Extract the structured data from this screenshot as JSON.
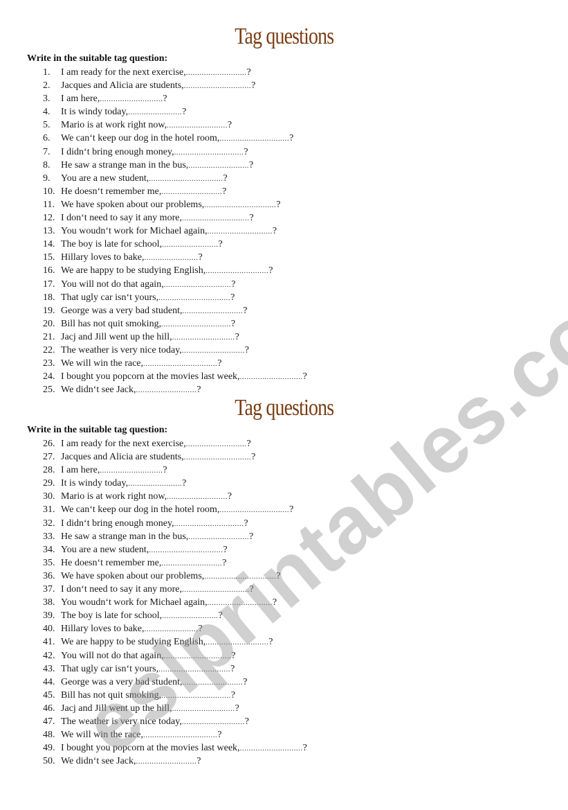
{
  "watermark": "eslprintables.com",
  "sections": [
    {
      "title": "Tag questions",
      "instruction": "Write in the suitable tag question:",
      "items": [
        {
          "num": "1.",
          "text": "I am ready for the next exercise,",
          "blank": "..........................."
        },
        {
          "num": "2.",
          "text": "Jacques and Alicia are students,",
          "blank": ".............................."
        },
        {
          "num": "3.",
          "text": "I am here,",
          "blank": "............................"
        },
        {
          "num": "4.",
          "text": "It is windy today,",
          "blank": "........................"
        },
        {
          "num": "5.",
          "text": "Mario is at work right now,",
          "blank": "..........................."
        },
        {
          "num": "6.",
          "text": "We can‘t keep our dog in the hotel room,",
          "blank": "..............................."
        },
        {
          "num": "7.",
          "text": "I didn‘t bring enough money,",
          "blank": "..............................."
        },
        {
          "num": "8.",
          "text": "He saw a strange man in the bus,",
          "blank": "..........................."
        },
        {
          "num": "9.",
          "text": "You are a new student,",
          "blank": "................................."
        },
        {
          "num": "10.",
          "text": "He doesn‘t remember me,",
          "blank": "..........................."
        },
        {
          "num": "11.",
          "text": "We have spoken about our problems,",
          "blank": "................................"
        },
        {
          "num": "12.",
          "text": "I don‘t need to say it any more,",
          "blank": ".............................."
        },
        {
          "num": "13.",
          "text": "You woudn‘t work for Michael again,",
          "blank": "............................."
        },
        {
          "num": "14.",
          "text": "The boy is late for school,",
          "blank": "........................."
        },
        {
          "num": "15.",
          "text": "Hillary loves to bake,",
          "blank": "........................"
        },
        {
          "num": "16.",
          "text": "We are happy to be studying English,",
          "blank": "............................"
        },
        {
          "num": "17.",
          "text": "You will not do that again,",
          "blank": ".............................."
        },
        {
          "num": "18.",
          "text": "That ugly car isn‘t yours,",
          "blank": "................................"
        },
        {
          "num": "19.",
          "text": "George was a very bad student,",
          "blank": "..........................."
        },
        {
          "num": "20.",
          "text": "Bill has not quit smoking,",
          "blank": "..............................."
        },
        {
          "num": "21.",
          "text": "Jacj and Jill went up the hill,",
          "blank": "............................"
        },
        {
          "num": "22.",
          "text": "The weather is very nice today,",
          "blank": "............................"
        },
        {
          "num": "23.",
          "text": "We will win the race,",
          "blank": "................................."
        },
        {
          "num": "24.",
          "text": "I bought you popcorn at the movies last week,",
          "blank": "............................"
        },
        {
          "num": "25.",
          "text": "We didn‘t see Jack,",
          "blank": "..........................."
        }
      ]
    },
    {
      "title": "Tag questions",
      "instruction": "Write in the suitable tag question:",
      "items": [
        {
          "num": "26.",
          "text": "I am ready for the next exercise,",
          "blank": "..........................."
        },
        {
          "num": "27.",
          "text": "Jacques and Alicia are students,",
          "blank": ".............................."
        },
        {
          "num": "28.",
          "text": "I am here,",
          "blank": "............................"
        },
        {
          "num": "29.",
          "text": "It is windy today,",
          "blank": "........................"
        },
        {
          "num": "30.",
          "text": "Mario is at work right now,",
          "blank": "..........................."
        },
        {
          "num": "31.",
          "text": "We can‘t keep our dog in the hotel room,",
          "blank": "..............................."
        },
        {
          "num": "32.",
          "text": "I didn‘t bring enough money,",
          "blank": "..............................."
        },
        {
          "num": "33.",
          "text": "He saw a strange man in the bus,",
          "blank": "..........................."
        },
        {
          "num": "34.",
          "text": "You are a new student,",
          "blank": "................................."
        },
        {
          "num": "35.",
          "text": "He doesn‘t remember me,",
          "blank": "..........................."
        },
        {
          "num": "36.",
          "text": "We have spoken about our problems,",
          "blank": "................................"
        },
        {
          "num": "37.",
          "text": "I don‘t need to say it any more,",
          "blank": ".............................."
        },
        {
          "num": "38.",
          "text": "You woudn‘t work for Michael again,",
          "blank": "............................."
        },
        {
          "num": "39.",
          "text": "The boy is late for school,",
          "blank": "........................."
        },
        {
          "num": "40.",
          "text": "Hillary loves to bake,",
          "blank": "........................"
        },
        {
          "num": "41.",
          "text": "We are happy to be studying English,",
          "blank": "............................"
        },
        {
          "num": "42.",
          "text": "You will not do that again,",
          "blank": ".............................."
        },
        {
          "num": "43.",
          "text": "That ugly car isn‘t yours,",
          "blank": "................................"
        },
        {
          "num": "44.",
          "text": "George was a very bad student,",
          "blank": "..........................."
        },
        {
          "num": "45.",
          "text": "Bill has not quit smoking,",
          "blank": "..............................."
        },
        {
          "num": "46.",
          "text": "Jacj and Jill went up the hill,",
          "blank": "............................"
        },
        {
          "num": "47.",
          "text": "The weather is very nice today,",
          "blank": "............................"
        },
        {
          "num": "48.",
          "text": "We will win the race,",
          "blank": "................................."
        },
        {
          "num": "49.",
          "text": "I bought you popcorn at the movies last week,",
          "blank": "............................"
        },
        {
          "num": "50.",
          "text": "We didn‘t see Jack,",
          "blank": "..........................."
        }
      ]
    }
  ],
  "question_mark": "?",
  "colors": {
    "title": "#7a3c12",
    "watermark": "#969696"
  }
}
